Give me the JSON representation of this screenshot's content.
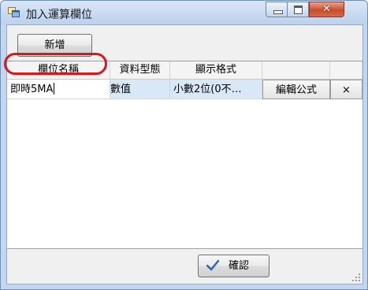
{
  "window": {
    "title": "加入運算欄位",
    "icon": "app-window-icon",
    "controls": [
      "minimize-icon",
      "maximize-icon",
      "close-icon"
    ],
    "close_glyph": "✕"
  },
  "toolbar": {
    "add_label": "新增"
  },
  "grid": {
    "columns": [
      "欄位名稱",
      "資料型態",
      "顯示格式"
    ],
    "rows": [
      {
        "name": "即時5MA",
        "type": "數值",
        "format": "小數2位(0不…",
        "edit_formula": "編輯公式",
        "delete": "×"
      }
    ]
  },
  "footer": {
    "ok_label": "確認",
    "ok_icon": "check-icon"
  },
  "colors": {
    "annotation": "#d9161c",
    "selection": "#d9e8f6",
    "close_button": "#c74b2e"
  }
}
